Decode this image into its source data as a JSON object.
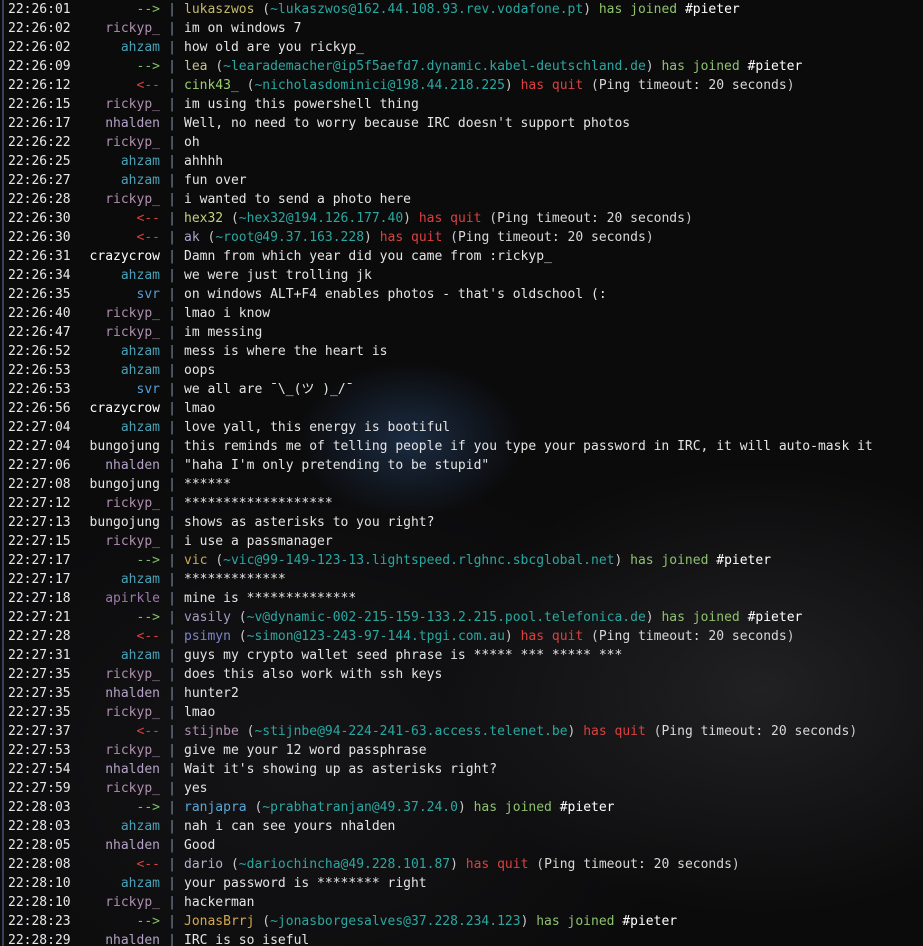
{
  "colors": {
    "background": "#0b0b0c",
    "host": "#2aa7a0",
    "join": "#8ec26e",
    "quit": "#d9413f"
  },
  "lines": [
    {
      "t": "22:26:01",
      "kind": "join",
      "nick": "lukaszwos",
      "nc": "#c6b96a",
      "host": "~lukaszwos@162.44.108.93.rev.vodafone.pt",
      "chan": "#pieter"
    },
    {
      "t": "22:26:02",
      "kind": "msg",
      "nick": "rickyp_",
      "nc": "#b08fb0",
      "text": "im on windows 7"
    },
    {
      "t": "22:26:02",
      "kind": "msg",
      "nick": "ahzam",
      "nc": "#4aa0b6",
      "text": "how old are you rickyp_"
    },
    {
      "t": "22:26:09",
      "kind": "join",
      "nick": "lea",
      "nc": "#c9c08a",
      "host": "~learademacher@ip5f5aefd7.dynamic.kabel-deutschland.de",
      "chan": "#pieter"
    },
    {
      "t": "22:26:12",
      "kind": "quit",
      "nick": "cink43_",
      "nc": "#9bd06e",
      "host": "~nicholasdominici@198.44.218.225",
      "reason": "Ping timeout: 20 seconds"
    },
    {
      "t": "22:26:15",
      "kind": "msg",
      "nick": "rickyp_",
      "nc": "#b08fb0",
      "text": "im using this powershell thing"
    },
    {
      "t": "22:26:17",
      "kind": "msg",
      "nick": "nhalden",
      "nc": "#b5a2c6",
      "text": "Well, no need to worry because IRC doesn't support photos"
    },
    {
      "t": "22:26:22",
      "kind": "msg",
      "nick": "rickyp_",
      "nc": "#b08fb0",
      "text": "oh"
    },
    {
      "t": "22:26:25",
      "kind": "msg",
      "nick": "ahzam",
      "nc": "#4aa0b6",
      "text": "ahhhh"
    },
    {
      "t": "22:26:27",
      "kind": "msg",
      "nick": "ahzam",
      "nc": "#4aa0b6",
      "text": "fun over"
    },
    {
      "t": "22:26:28",
      "kind": "msg",
      "nick": "rickyp_",
      "nc": "#b08fb0",
      "text": "i wanted to send a photo here"
    },
    {
      "t": "22:26:30",
      "kind": "quit",
      "nick": "hex32",
      "nc": "#c2d27a",
      "host": "~hex32@194.126.177.40",
      "reason": "Ping timeout: 20 seconds"
    },
    {
      "t": "22:26:30",
      "kind": "quit",
      "nick": "ak",
      "nc": "#a7a7c9",
      "host": "~root@49.37.163.228",
      "reason": "Ping timeout: 20 seconds"
    },
    {
      "t": "22:26:31",
      "kind": "msg",
      "nick": "crazycrow",
      "nc": "#ffffff",
      "text": "Damn from which year did you came from :rickyp_"
    },
    {
      "t": "22:26:34",
      "kind": "msg",
      "nick": "ahzam",
      "nc": "#4aa0b6",
      "text": "we were just trolling jk"
    },
    {
      "t": "22:26:35",
      "kind": "msg",
      "nick": "svr",
      "nc": "#5a9ed6",
      "text": "on windows ALT+F4 enables photos - that's oldschool (:"
    },
    {
      "t": "22:26:40",
      "kind": "msg",
      "nick": "rickyp_",
      "nc": "#b08fb0",
      "text": "lmao i know"
    },
    {
      "t": "22:26:47",
      "kind": "msg",
      "nick": "rickyp_",
      "nc": "#b08fb0",
      "text": "im messing"
    },
    {
      "t": "22:26:52",
      "kind": "msg",
      "nick": "ahzam",
      "nc": "#4aa0b6",
      "text": "mess is where the heart is"
    },
    {
      "t": "22:26:53",
      "kind": "msg",
      "nick": "ahzam",
      "nc": "#4aa0b6",
      "text": "oops"
    },
    {
      "t": "22:26:53",
      "kind": "msg",
      "nick": "svr",
      "nc": "#5a9ed6",
      "text": "we all are ¯\\_(ツ )_/¯"
    },
    {
      "t": "22:26:56",
      "kind": "msg",
      "nick": "crazycrow",
      "nc": "#ffffff",
      "text": "lmao"
    },
    {
      "t": "22:27:04",
      "kind": "msg",
      "nick": "ahzam",
      "nc": "#4aa0b6",
      "text": "love yall, this energy is bootiful"
    },
    {
      "t": "22:27:04",
      "kind": "msg",
      "nick": "bungojung",
      "nc": "#e6e6e6",
      "text": "this reminds me of telling people if you type your password in IRC, it will auto-mask it"
    },
    {
      "t": "22:27:06",
      "kind": "msg",
      "nick": "nhalden",
      "nc": "#b5a2c6",
      "text": "\"haha I'm only pretending to be stupid\""
    },
    {
      "t": "22:27:08",
      "kind": "msg",
      "nick": "bungojung",
      "nc": "#e6e6e6",
      "text": "******"
    },
    {
      "t": "22:27:12",
      "kind": "msg",
      "nick": "rickyp_",
      "nc": "#b08fb0",
      "text": "*******************"
    },
    {
      "t": "22:27:13",
      "kind": "msg",
      "nick": "bungojung",
      "nc": "#e6e6e6",
      "text": "shows as asterisks to you right?"
    },
    {
      "t": "22:27:15",
      "kind": "msg",
      "nick": "rickyp_",
      "nc": "#b08fb0",
      "text": "i use a passmanager"
    },
    {
      "t": "22:27:17",
      "kind": "join",
      "nick": "vic",
      "nc": "#c9a85a",
      "host": "~vic@99-149-123-13.lightspeed.rlghnc.sbcglobal.net",
      "chan": "#pieter"
    },
    {
      "t": "22:27:17",
      "kind": "msg",
      "nick": "ahzam",
      "nc": "#4aa0b6",
      "text": "*************"
    },
    {
      "t": "22:27:18",
      "kind": "msg",
      "nick": "apirkle",
      "nc": "#9a7aa8",
      "text": "mine is **************"
    },
    {
      "t": "22:27:21",
      "kind": "join",
      "nick": "vasily",
      "nc": "#a99bc2",
      "host": "~v@dynamic-002-215-159-133.2.215.pool.telefonica.de",
      "chan": "#pieter"
    },
    {
      "t": "22:27:28",
      "kind": "quit",
      "nick": "psimyn",
      "nc": "#7a86c6",
      "host": "~simon@123-243-97-144.tpgi.com.au",
      "reason": "Ping timeout: 20 seconds"
    },
    {
      "t": "22:27:31",
      "kind": "msg",
      "nick": "ahzam",
      "nc": "#4aa0b6",
      "text": "guys my crypto wallet seed phrase is ***** *** ***** ***"
    },
    {
      "t": "22:27:35",
      "kind": "msg",
      "nick": "rickyp_",
      "nc": "#b08fb0",
      "text": "does this also work with ssh keys"
    },
    {
      "t": "22:27:35",
      "kind": "msg",
      "nick": "nhalden",
      "nc": "#b5a2c6",
      "text": "hunter2"
    },
    {
      "t": "22:27:35",
      "kind": "msg",
      "nick": "rickyp_",
      "nc": "#b08fb0",
      "text": "lmao"
    },
    {
      "t": "22:27:37",
      "kind": "quit",
      "nick": "stijnbe",
      "nc": "#b08fb0",
      "host": "~stijnbe@94-224-241-63.access.telenet.be",
      "reason": "Ping timeout: 20 seconds"
    },
    {
      "t": "22:27:53",
      "kind": "msg",
      "nick": "rickyp_",
      "nc": "#b08fb0",
      "text": "give me your 12 word passphrase"
    },
    {
      "t": "22:27:54",
      "kind": "msg",
      "nick": "nhalden",
      "nc": "#b5a2c6",
      "text": "Wait it's showing up as asterisks right?"
    },
    {
      "t": "22:27:59",
      "kind": "msg",
      "nick": "rickyp_",
      "nc": "#b08fb0",
      "text": "yes"
    },
    {
      "t": "22:28:03",
      "kind": "join",
      "nick": "ranjapra",
      "nc": "#5aa7d6",
      "host": "~prabhatranjan@49.37.24.0",
      "chan": "#pieter"
    },
    {
      "t": "22:28:03",
      "kind": "msg",
      "nick": "ahzam",
      "nc": "#4aa0b6",
      "text": "nah i can see yours nhalden"
    },
    {
      "t": "22:28:05",
      "kind": "msg",
      "nick": "nhalden",
      "nc": "#b5a2c6",
      "text": "Good"
    },
    {
      "t": "22:28:08",
      "kind": "quit",
      "nick": "dario",
      "nc": "#b7b0c9",
      "host": "~dariochincha@49.228.101.87",
      "reason": "Ping timeout: 20 seconds"
    },
    {
      "t": "22:28:10",
      "kind": "msg",
      "nick": "ahzam",
      "nc": "#4aa0b6",
      "text": "your password is ********  right"
    },
    {
      "t": "22:28:10",
      "kind": "msg",
      "nick": "rickyp_",
      "nc": "#b08fb0",
      "text": "hackerman"
    },
    {
      "t": "22:28:23",
      "kind": "join",
      "nick": "JonasBrrj",
      "nc": "#d6a84a",
      "host": "~jonasborgesalves@37.228.234.123",
      "chan": "#pieter"
    },
    {
      "t": "22:28:29",
      "kind": "msg",
      "nick": "nhalden",
      "nc": "#b5a2c6",
      "text": "IRC is so iseful"
    }
  ],
  "labels": {
    "join_arrow": "-->",
    "quit_arrow": "<--",
    "separator": "|",
    "has_joined": "has joined",
    "has_quit": "has quit"
  }
}
